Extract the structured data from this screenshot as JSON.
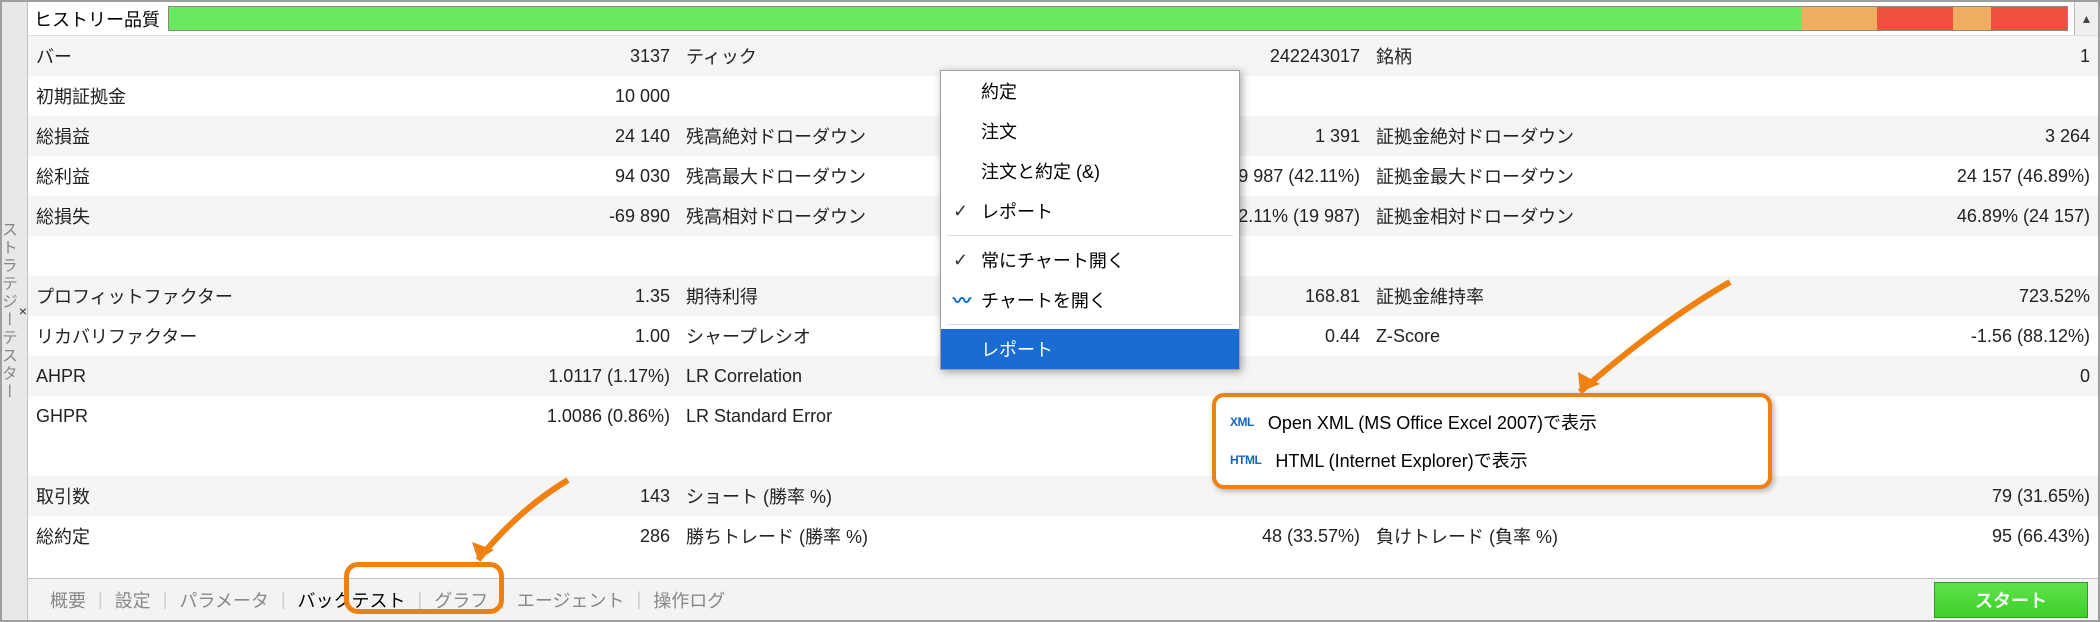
{
  "sidebar": {
    "close": "×",
    "label": "ストラテジーテスター"
  },
  "history_label": "ヒストリー品質",
  "rows": [
    {
      "c": [
        {
          "t": "バー"
        },
        {
          "t": "3137",
          "v": 1
        },
        {
          "t": "ティック"
        },
        {
          "t": "242243017",
          "v": 1
        },
        {
          "t": "銘柄"
        },
        {
          "t": "1",
          "v": 1
        }
      ]
    },
    {
      "c": [
        {
          "t": "初期証拠金"
        },
        {
          "t": "10 000",
          "v": 1
        },
        {
          "t": ""
        },
        {
          "t": ""
        },
        {
          "t": ""
        },
        {
          "t": ""
        }
      ]
    },
    {
      "c": [
        {
          "t": "総損益"
        },
        {
          "t": "24 140",
          "v": 1
        },
        {
          "t": "残高絶対ドローダウン"
        },
        {
          "t": "1 391",
          "v": 1
        },
        {
          "t": "証拠金絶対ドローダウン"
        },
        {
          "t": "3 264",
          "v": 1
        }
      ]
    },
    {
      "c": [
        {
          "t": "総利益"
        },
        {
          "t": "94 030",
          "v": 1
        },
        {
          "t": "残高最大ドローダウン"
        },
        {
          "t": "19 987 (42.11%)",
          "v": 1
        },
        {
          "t": "証拠金最大ドローダウン"
        },
        {
          "t": "24 157 (46.89%)",
          "v": 1
        }
      ]
    },
    {
      "c": [
        {
          "t": "総損失"
        },
        {
          "t": "-69 890",
          "v": 1
        },
        {
          "t": "残高相対ドローダウン"
        },
        {
          "t": "42.11% (19 987)",
          "v": 1
        },
        {
          "t": "証拠金相対ドローダウン"
        },
        {
          "t": "46.89% (24 157)",
          "v": 1
        }
      ]
    },
    {
      "c": [
        {
          "t": ""
        },
        {
          "t": ""
        },
        {
          "t": ""
        },
        {
          "t": ""
        },
        {
          "t": ""
        },
        {
          "t": ""
        }
      ]
    },
    {
      "c": [
        {
          "t": "プロフィットファクター"
        },
        {
          "t": "1.35",
          "v": 1
        },
        {
          "t": "期待利得"
        },
        {
          "t": "168.81",
          "v": 1
        },
        {
          "t": "証拠金維持率"
        },
        {
          "t": "723.52%",
          "v": 1
        }
      ]
    },
    {
      "c": [
        {
          "t": "リカバリファクター"
        },
        {
          "t": "1.00",
          "v": 1
        },
        {
          "t": "シャープレシオ"
        },
        {
          "t": "0.44",
          "v": 1
        },
        {
          "t": "Z-Score"
        },
        {
          "t": "-1.56 (88.12%)",
          "v": 1
        }
      ]
    },
    {
      "c": [
        {
          "t": "AHPR"
        },
        {
          "t": "1.0117 (1.17%)",
          "v": 1
        },
        {
          "t": "LR Correlation"
        },
        {
          "t": "",
          "v": 1
        },
        {
          "t": ""
        },
        {
          "t": "0",
          "v": 1
        }
      ]
    },
    {
      "c": [
        {
          "t": "GHPR"
        },
        {
          "t": "1.0086 (0.86%)",
          "v": 1
        },
        {
          "t": "LR Standard Error"
        },
        {
          "t": "",
          "v": 1
        },
        {
          "t": ""
        },
        {
          "t": "",
          "v": 1
        }
      ]
    },
    {
      "c": [
        {
          "t": ""
        },
        {
          "t": ""
        },
        {
          "t": ""
        },
        {
          "t": ""
        },
        {
          "t": ""
        },
        {
          "t": ""
        }
      ]
    },
    {
      "c": [
        {
          "t": "取引数"
        },
        {
          "t": "143",
          "v": 1
        },
        {
          "t": "ショート (勝率 %)"
        },
        {
          "t": "",
          "v": 1
        },
        {
          "t": ""
        },
        {
          "t": "79 (31.65%)",
          "v": 1
        }
      ]
    },
    {
      "c": [
        {
          "t": "総約定"
        },
        {
          "t": "286",
          "v": 1
        },
        {
          "t": "勝ちトレード (勝率 %)"
        },
        {
          "t": "48 (33.57%)",
          "v": 1
        },
        {
          "t": "負けトレード (負率 %)"
        },
        {
          "t": "95 (66.43%)",
          "v": 1
        }
      ]
    }
  ],
  "alt_rows": [
    0,
    2,
    4,
    6,
    8,
    11
  ],
  "context": {
    "items": [
      {
        "label": "約定"
      },
      {
        "label": "注文"
      },
      {
        "label": "注文と約定 (&)"
      },
      {
        "label": "レポート",
        "check": true
      },
      {
        "sep": true
      },
      {
        "label": "常にチャート開く",
        "check": true
      },
      {
        "label": "チャートを開く",
        "chart": true
      },
      {
        "sep": true
      },
      {
        "label": "レポート",
        "selected": true
      }
    ]
  },
  "submenu": {
    "items": [
      {
        "ico": "XML",
        "label": "Open XML (MS Office Excel 2007)で表示"
      },
      {
        "ico": "HTML",
        "label": "HTML (Internet Explorer)で表示"
      }
    ]
  },
  "tabs": {
    "items": [
      "概要",
      "設定",
      "パラメータ",
      "バックテスト",
      "グラフ",
      "エージェント",
      "操作ログ"
    ],
    "active": 3,
    "start": "スタート"
  }
}
